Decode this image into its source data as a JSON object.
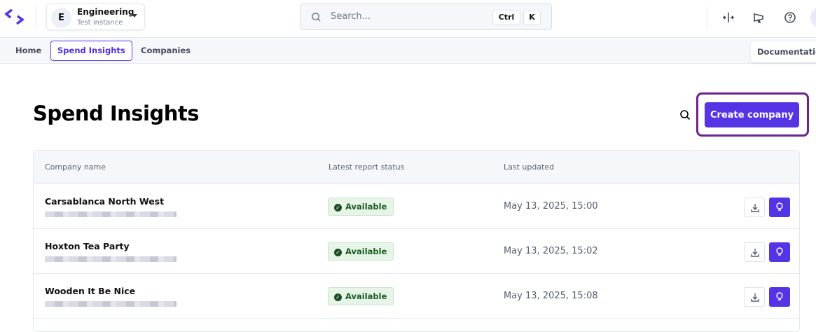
{
  "header": {
    "org": {
      "initial": "E",
      "name": "Engineering",
      "subtitle": "Test instance"
    },
    "search": {
      "placeholder": "Search...",
      "shortcut": [
        "Ctrl",
        "K"
      ]
    },
    "icons": [
      "logo-icon",
      "split-view-icon",
      "announcement-icon",
      "help-icon",
      "avatar"
    ]
  },
  "nav": {
    "tabs": [
      {
        "label": "Home"
      },
      {
        "label": "Spend Insights",
        "active": true
      },
      {
        "label": "Companies"
      }
    ],
    "documentation": "Documentation"
  },
  "page": {
    "title": "Spend Insights",
    "create_button": "Create company"
  },
  "table": {
    "columns": [
      "Company name",
      "Latest report status",
      "Last updated"
    ],
    "rows": [
      {
        "name": "Carsablanca North West",
        "status": "Available",
        "updated": "May 13, 2025, 15:00"
      },
      {
        "name": "Hoxton Tea Party",
        "status": "Available",
        "updated": "May 13, 2025, 15:02"
      },
      {
        "name": "Wooden It Be Nice",
        "status": "Available",
        "updated": "May 13, 2025, 15:08"
      }
    ]
  },
  "colors": {
    "accent": "#5534e6",
    "focus": "#6a2390",
    "success_bg": "#e6f5e8",
    "success_text": "#1b5c22"
  }
}
